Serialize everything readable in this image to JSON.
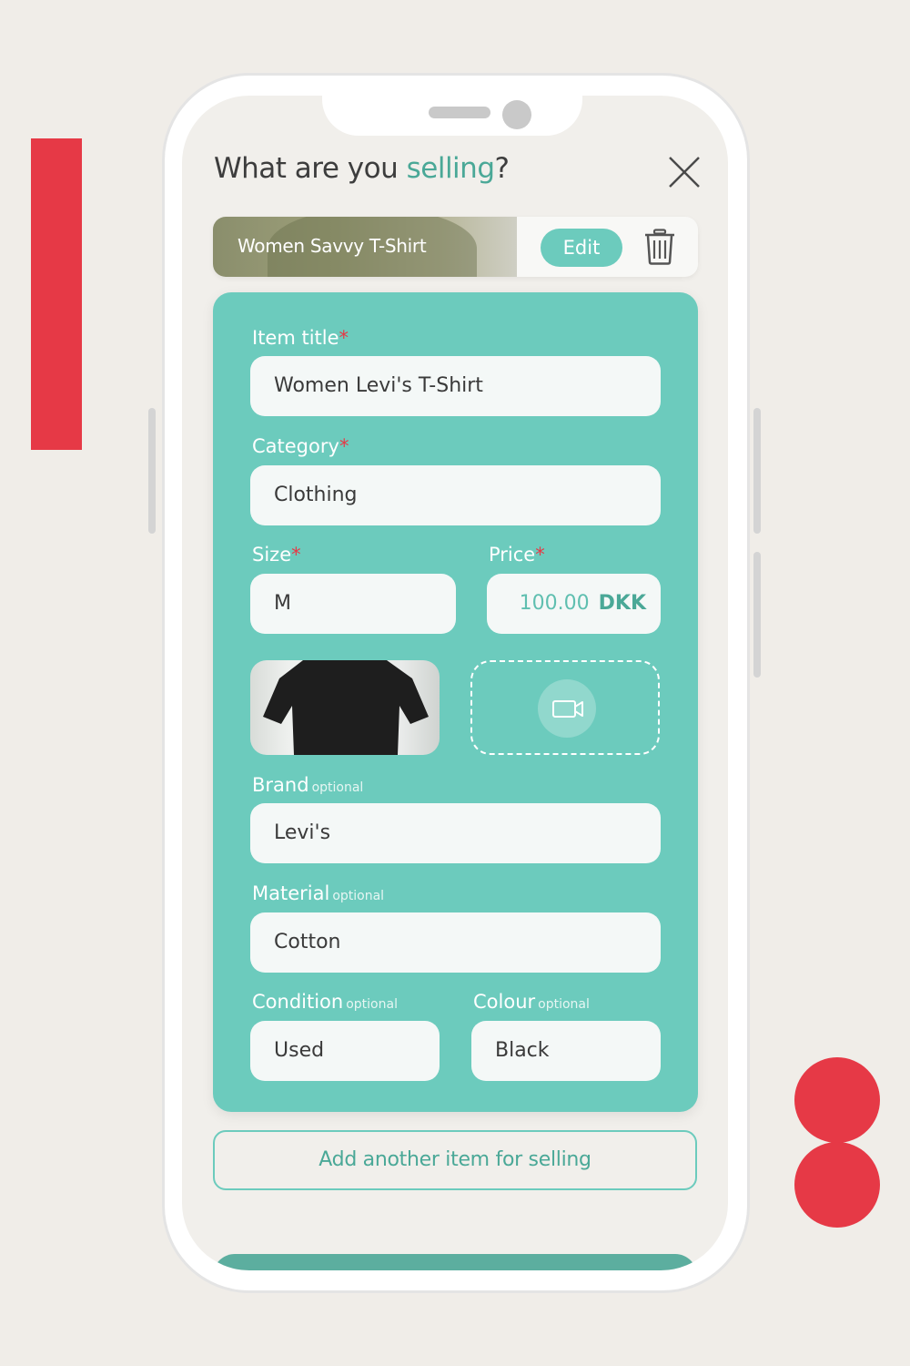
{
  "colors": {
    "accent": "#6ccbbd",
    "accent_dark": "#4aa897",
    "required": "#e63946",
    "decor": "#e63946"
  },
  "header": {
    "title_prefix": "What are you ",
    "title_accent": "selling",
    "title_suffix": "?"
  },
  "item_card": {
    "name": "Women Savvy T-Shirt",
    "edit_label": "Edit",
    "icons": [
      "trash-icon"
    ]
  },
  "form": {
    "item_title": {
      "label": "Item title",
      "required_mark": "*",
      "value": "Women Levi's T-Shirt"
    },
    "category": {
      "label": "Category",
      "required_mark": "*",
      "value": "Clothing"
    },
    "size": {
      "label": "Size",
      "required_mark": "*",
      "value": "M"
    },
    "price": {
      "label": "Price",
      "required_mark": "*",
      "amount": "100.00",
      "currency": "DKK"
    },
    "brand": {
      "label": "Brand",
      "optional": "optional",
      "value": "Levi's"
    },
    "material": {
      "label": "Material",
      "optional": "optional",
      "value": "Cotton"
    },
    "condition": {
      "label": "Condition",
      "optional": "optional",
      "value": "Used"
    },
    "colour": {
      "label": "Colour",
      "optional": "optional",
      "value": "Black"
    }
  },
  "add_another": {
    "label": "Add another item for selling"
  },
  "icons": [
    "close-icon",
    "trash-icon",
    "video-camera-icon"
  ]
}
